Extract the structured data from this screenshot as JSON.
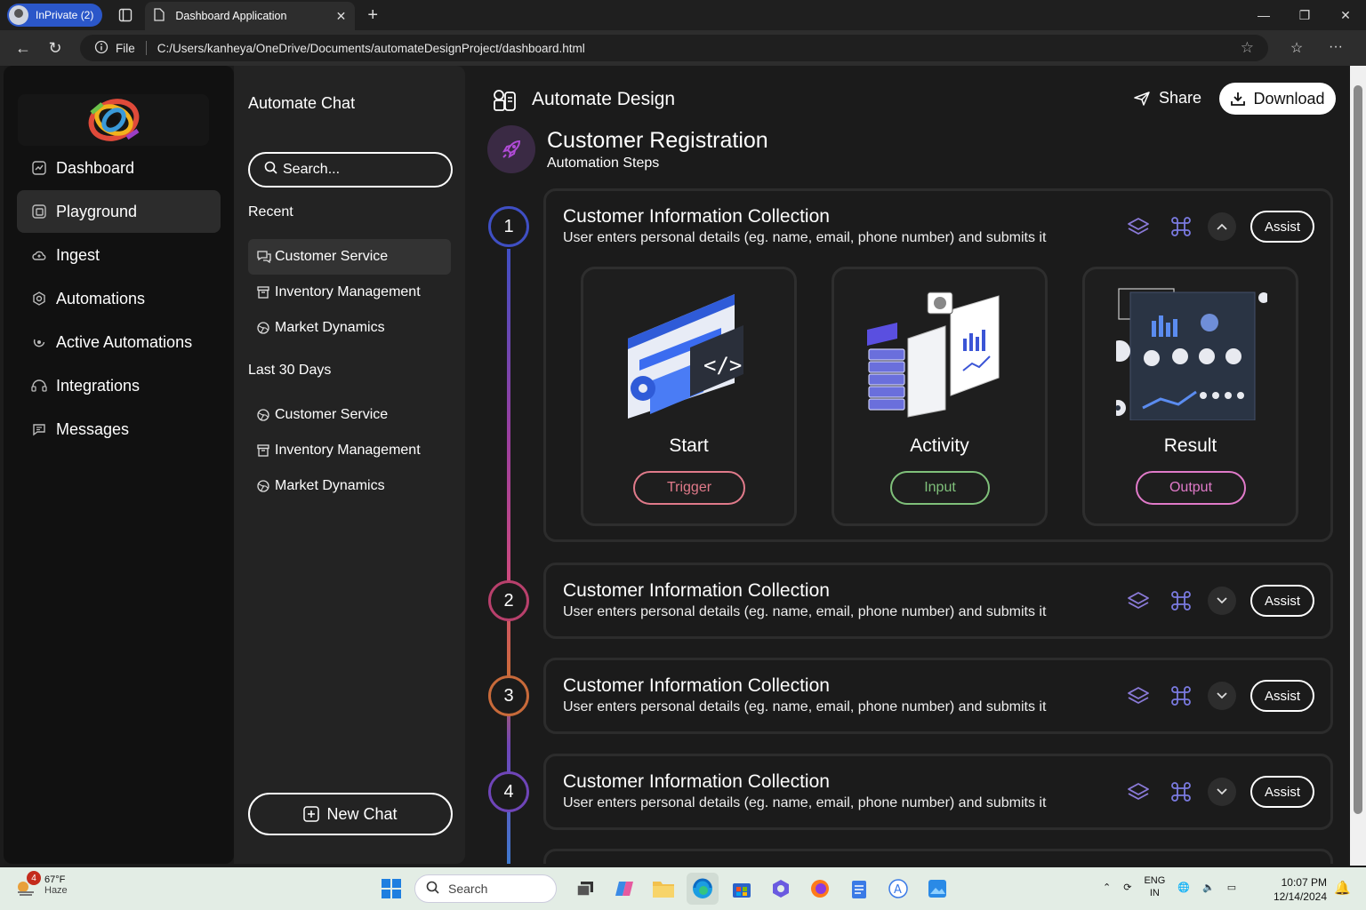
{
  "browser": {
    "inprivate_label": "InPrivate (2)",
    "tab_title": "Dashboard Application",
    "file_label": "File",
    "url": "C:/Users/kanheya/OneDrive/Documents/automateDesignProject/dashboard.html"
  },
  "sidebar": {
    "items": [
      {
        "label": "Dashboard",
        "icon": "chart-icon"
      },
      {
        "label": "Playground",
        "icon": "playground-icon"
      },
      {
        "label": "Ingest",
        "icon": "cloud-icon"
      },
      {
        "label": "Automations",
        "icon": "gear-icon"
      },
      {
        "label": "Active Automations",
        "icon": "refresh-icon"
      },
      {
        "label": "Integrations",
        "icon": "integration-icon"
      },
      {
        "label": "Messages",
        "icon": "message-icon"
      }
    ],
    "active": "Playground"
  },
  "chat_panel": {
    "title": "Automate Chat",
    "search_placeholder": "Search...",
    "recent_label": "Recent",
    "recent": [
      "Customer Service",
      "Inventory Management",
      "Market Dynamics"
    ],
    "last30_label": "Last 30 Days",
    "last30": [
      "Customer Service",
      "Inventory Management",
      "Market Dynamics"
    ],
    "new_chat_label": "New Chat"
  },
  "main": {
    "title": "Automate Design",
    "share_label": "Share",
    "download_label": "Download",
    "project_title": "Customer Registration",
    "project_subtitle": "Automation Steps",
    "steps": [
      {
        "number": "1",
        "title": "Customer Information Collection",
        "desc": "User enters personal details (eg. name, email, phone number) and submits it",
        "assist": "Assist",
        "expanded": true
      },
      {
        "number": "2",
        "title": "Customer Information Collection",
        "desc": "User enters personal details (eg. name, email, phone number) and submits it",
        "assist": "Assist",
        "expanded": false
      },
      {
        "number": "3",
        "title": "Customer Information Collection",
        "desc": "User enters personal details (eg. name, email, phone number) and submits it",
        "assist": "Assist",
        "expanded": false
      },
      {
        "number": "4",
        "title": "Customer Information Collection",
        "desc": "User enters personal details (eg. name, email, phone number) and submits it",
        "assist": "Assist",
        "expanded": false
      }
    ],
    "stages": [
      {
        "label": "Start",
        "pill": "Trigger",
        "color": "#e07a8a"
      },
      {
        "label": "Activity",
        "pill": "Input",
        "color": "#7fc07a"
      },
      {
        "label": "Result",
        "pill": "Output",
        "color": "#e07ac9"
      }
    ]
  },
  "taskbar": {
    "weather_temp": "67°F",
    "weather_desc": "Haze",
    "weather_badge": "4",
    "search_label": "Search",
    "lang_top": "ENG",
    "lang_bottom": "IN",
    "time": "10:07 PM",
    "date": "12/14/2024"
  }
}
